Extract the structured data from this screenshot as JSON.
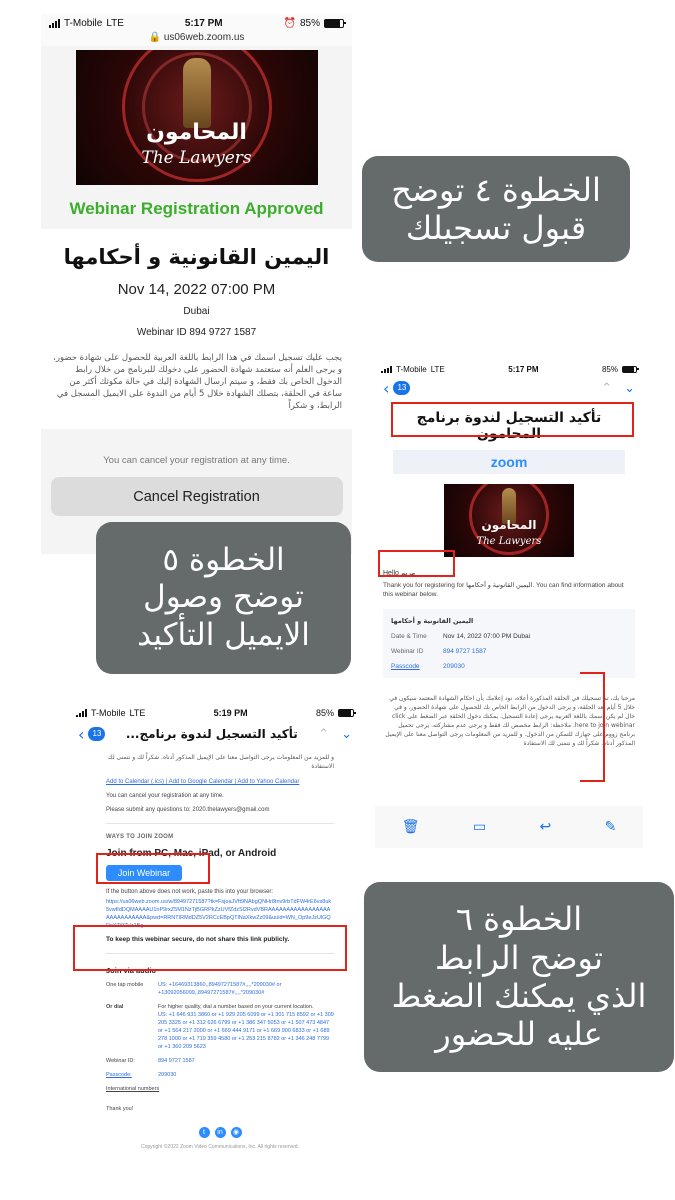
{
  "shot1": {
    "status": {
      "carrier": "T-Mobile",
      "network": "LTE",
      "time": "5:17 PM",
      "battery": "85%",
      "battery_fraction": 0.85
    },
    "url": "us06web.zoom.us",
    "banner": {
      "title_ar": "المحامون",
      "title_en": "The Lawyers"
    },
    "approved": "Webinar Registration Approved",
    "event_title": "اليمين القانونية و أحكامها",
    "date": "Nov 14, 2022 07:00 PM",
    "city": "Dubai",
    "webinar_id": "Webinar ID 894 9727 1587",
    "description": "يجب عليك تسجيل اسمك في هذا الرابط باللغة العربية للحصول على شهادة حضور، و يرجى العلم أنه ستعتمد شهادة الحضور على دخولك للبرنامج من خلال رابط الدخول الخاص بك فقط، و سيتم ارسال الشهادة إليك في حالة مكوثك أكثر من ساعة في الحلقة، بتصلك الشهادة خلال 5 أيام من الندوة على الايميل المسجل في الرابط، و شكراً",
    "cancel_note": "You can cancel your registration at any time.",
    "cancel_button": "Cancel Registration"
  },
  "shot2": {
    "status": {
      "carrier": "T-Mobile",
      "network": "LTE",
      "time": "5:17 PM",
      "battery": "85%",
      "battery_fraction": 0.85
    },
    "badge": "13",
    "subject": "تأكيد التسجيل لندوة برنامج المحامون",
    "zoom": "zoom",
    "banner": {
      "title_ar": "المحامون",
      "title_en": "The Lawyers"
    },
    "hello": "Hello مريم",
    "thanks": "Thank you for registering for اليمين القانونية و أحكامها. You can find information about this webinar below.",
    "info_title": "اليمين القانونية و أحكامها",
    "rows": [
      {
        "k": "Date & Time",
        "v": "Nov 14, 2022 07:00 PM Dubai",
        "link": false
      },
      {
        "k": "Webinar ID",
        "v": "894 9727 1587",
        "link": true
      },
      {
        "k": "Passcode",
        "v": "209030",
        "link": true
      }
    ],
    "arabic_body": "مرحبا بك، تم تسجيلك في الحلقة المذكورة أعلاه، نود إعلامك بأن احكام الشهادة المعتمد سيكون في خلال 5 أيام بعد الحلقة، و يرجى الدخول من الرابط الخاص بك للحصول على شهادة الحضور، و في حال لم يكن اسمك باللغة العربية يرجى إعادة التسجيل. يمكنك دخول الحلقة عبر الضغط على click here to join webinar. ملاحظة: الرابط مخصص لك فقط و يرجى عدم مشاركته. يرجى تحميل برنامج زووم على جهازك للتمكن من الدخول. و للمزيد من المعلومات يرجى التواصل معنا على الإيميل المذكور أدناه. شكراً لك و نتمنى لك الاستفادة"
  },
  "shot3": {
    "status": {
      "carrier": "T-Mobile",
      "network": "LTE",
      "time": "5:19 PM",
      "battery": "85%",
      "battery_fraction": 0.85
    },
    "badge": "13",
    "subject": "تأكيد التسجيل لندوة برنامج...",
    "arabic_top": "و للمزيد من المعلومات يرجى التواصل معنا على الإيميل المذكور أدناه. شكراً لك و نتمنى لك الاستفادة",
    "calendar_links": "Add to Calendar (.ics) | Add to Google Calendar | Add to Yahoo Calendar",
    "cancel_text": "You can cancel your registration at any time.",
    "questions": "Please submit any questions to: 2020.thelawyers@gmail.com",
    "ways": "WAYS TO JOIN ZOOM",
    "join_from": "Join from PC, Mac, iPad, or Android",
    "join_button": "Join Webinar",
    "if_button": "If the button above does not work, paste this into your browser:",
    "url": "https://us06web.zoom.us/w/89497271587?tk=FsjoaJVft9NAbgQNHr8tnv9rbTdFW4rE6vs8uk5vwfIdDQMAAAAU1nP9rxZ5M1NzTjBGRPkZzUVfZdzSl2RvdVBRAAAAAAAAAAAAAAAAAAAAAAAAAAAA&pwd=RRNTIRMdDZ5V2RCcEBpQTlNaXkwZz09&uuid=WN_Op9eJzUlGQRnXTi97Vz1Bg",
    "secure": "To keep this webinar secure, do not share this link publicly.",
    "audio": "Join via audio",
    "one_tap_k": "One tap mobile",
    "one_tap_v": "US: +16469313860,,89497271587#,,,,*209030# or +13092056099,,89497271587#,,,,*209030#",
    "or_dial_k": "Or dial",
    "or_dial_note": "For higher quality, dial a number based on your current location.",
    "or_dial_v": "US: +1 646 931 3860 or +1 929 205 6099 or +1 301 715 8592 or +1 309 205 3325 or +1 312 626 6799 or +1 386 347 5053 or +1 507 473 4847 or +1 564 217 2000 or +1 669 444 9171 or +1 669 900 6833 or +1 689 278 1000 or +1 719 359 4580 or +1 253 215 8782 or +1 346 248 7799 or +1 360 209 5623",
    "webinar_id_k": "Webinar ID:",
    "webinar_id_v": "894 9727 1587",
    "passcode_k": "Passcode:",
    "passcode_v": "209030",
    "intl": "International numbers",
    "thank_you": "Thank you!",
    "copyright": "Copyright ©2022 Zoom Video Communications, Inc. All rights reserved."
  },
  "captions": {
    "step4": [
      "الخطوة ٤ توضح",
      "قبول تسجيلك"
    ],
    "step5": [
      "الخطوة ٥",
      "توضح وصول",
      "الايميل التأكيد"
    ],
    "step6": [
      "الخطوة ٦",
      "توضح الرابط",
      "الذي يمكنك الضغط",
      "عليه للحضور"
    ]
  },
  "colors": {
    "approved_green": "#3cae2c",
    "annotation_red": "#e2231a",
    "caption_bg": "#656a6b",
    "zoom_blue": "#2d8cff",
    "ios_blue": "#1a73e8"
  },
  "icons": {
    "back": "chevron-left-icon",
    "up": "chevron-up-icon",
    "down": "chevron-down-icon",
    "trash": "trash-icon",
    "folder": "folder-icon",
    "reply": "reply-icon",
    "compose": "compose-icon",
    "lock": "lock-icon"
  }
}
